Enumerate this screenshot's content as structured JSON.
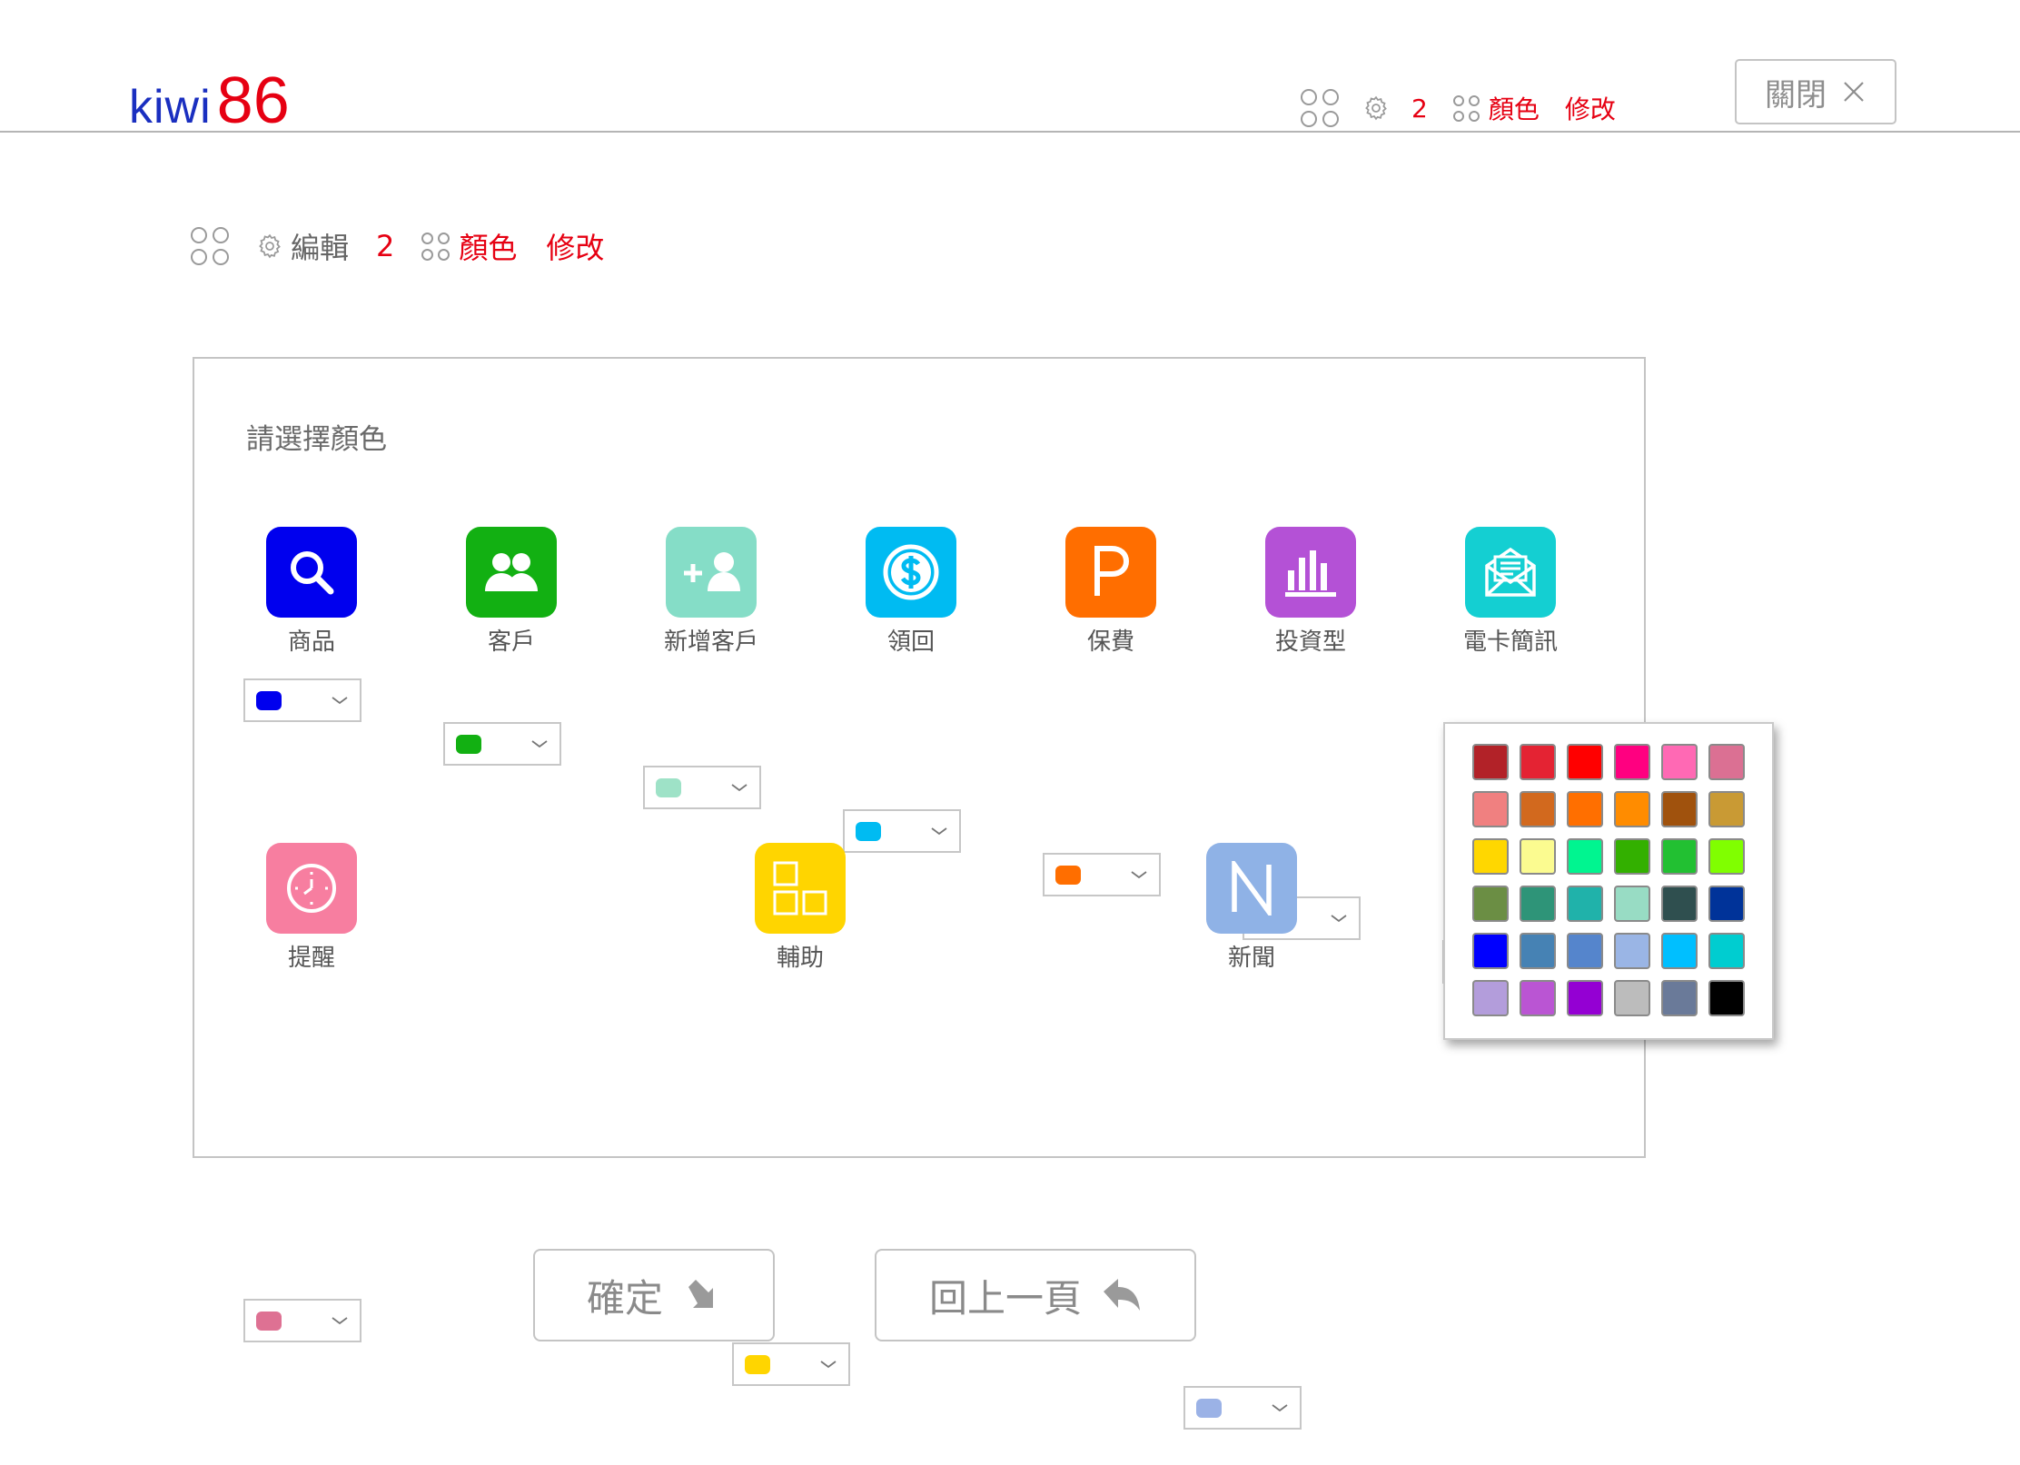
{
  "header": {
    "logo_text": "kiwi",
    "logo_number": "86",
    "breadcrumb": {
      "count": "2",
      "section": "顏色",
      "action": "修改"
    },
    "close_label": "關閉"
  },
  "breadcrumb": {
    "edit": "編輯",
    "count": "2",
    "section": "顏色",
    "action": "修改"
  },
  "panel": {
    "title": "請選擇顏色",
    "items": [
      {
        "label": "商品",
        "icon": "search-icon",
        "color": "#0000ee"
      },
      {
        "label": "客戶",
        "icon": "customers-icon",
        "color": "#12b012"
      },
      {
        "label": "新增客戶",
        "icon": "add-customer-icon",
        "color": "#85ddc7"
      },
      {
        "label": "領回",
        "icon": "dollar-icon",
        "color": "#00bbf2"
      },
      {
        "label": "保費",
        "icon": "premium-p-icon",
        "color": "#ff6e00"
      },
      {
        "label": "投資型",
        "icon": "bar-chart-icon",
        "color": "#b451d6"
      },
      {
        "label": "電卡簡訊",
        "icon": "mail-icon",
        "color": "#14cfd2"
      },
      {
        "label": "提醒",
        "icon": "clock-icon",
        "color": "#f77ea0"
      },
      {
        "label": "輔助",
        "icon": "squares-icon",
        "color": "#ffd500"
      },
      {
        "label": "新聞",
        "icon": "news-n-icon",
        "color": "#8fb2e6"
      }
    ],
    "select_swatches": [
      "#0000ee",
      "#12b012",
      "#9ee2c7",
      "#00bbf2",
      "#ff6e00",
      "#b451d6",
      "#14cfd2",
      "#de7193",
      "#ffd500",
      "#9bb2e6"
    ]
  },
  "palette": {
    "colors": [
      "#b22228",
      "#e42333",
      "#ff0000",
      "#ff0080",
      "#ff69b4",
      "#db7093",
      "#f08080",
      "#d2691e",
      "#ff6f00",
      "#ff8c00",
      "#a0520d",
      "#c99a34",
      "#ffd700",
      "#fbfb90",
      "#00f590",
      "#33b000",
      "#22c032",
      "#80ff00",
      "#6b8e44",
      "#2e9478",
      "#20b2aa",
      "#98dcc4",
      "#2f4f4f",
      "#003399",
      "#0000ff",
      "#4682b4",
      "#5585cc",
      "#9ab5e5",
      "#00bfff",
      "#00cdd0",
      "#b39ddb",
      "#ba55d3",
      "#9400d3",
      "#bcbcbc",
      "#6a7a99",
      "#000000"
    ]
  },
  "buttons": {
    "confirm": "確定",
    "back": "回上一頁"
  }
}
